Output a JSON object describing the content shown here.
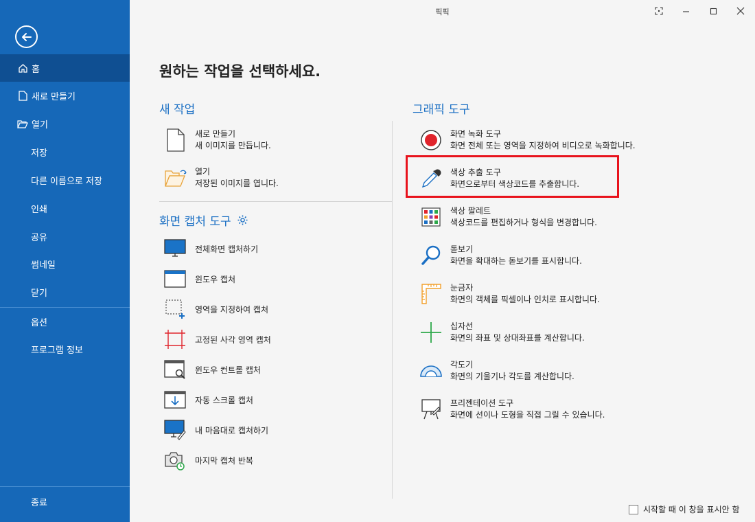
{
  "window": {
    "title": "픽픽"
  },
  "sidebar": {
    "items": [
      {
        "label": "홈",
        "icon": "home-icon"
      },
      {
        "label": "새로 만들기",
        "icon": "new-file-icon"
      },
      {
        "label": "열기",
        "icon": "folder-open-icon"
      },
      {
        "label": "저장"
      },
      {
        "label": "다른 이름으로 저장"
      },
      {
        "label": "인쇄"
      },
      {
        "label": "공유"
      },
      {
        "label": "썸네일"
      },
      {
        "label": "닫기"
      },
      {
        "label": "옵션"
      },
      {
        "label": "프로그램 정보"
      },
      {
        "label": "종료"
      }
    ]
  },
  "main": {
    "heading": "원하는 작업을 선택하세요.",
    "new_task": {
      "title": "새 작업",
      "items": [
        {
          "title": "새로 만들기",
          "desc": "새 이미지를 만듭니다."
        },
        {
          "title": "열기",
          "desc": "저장된 이미지를 엽니다."
        }
      ]
    },
    "capture": {
      "title": "화면 캡처 도구",
      "items": [
        {
          "label": "전체화면 캡처하기"
        },
        {
          "label": "윈도우 캡처"
        },
        {
          "label": "영역을 지정하여 캡처"
        },
        {
          "label": "고정된 사각 영역 캡처"
        },
        {
          "label": "윈도우 컨트롤 캡처"
        },
        {
          "label": "자동 스크롤 캡처"
        },
        {
          "label": "내 마음대로 캡처하기"
        },
        {
          "label": "마지막 캡처 반복"
        }
      ]
    },
    "graphic": {
      "title": "그래픽 도구",
      "items": [
        {
          "title": "화면 녹화 도구",
          "desc": "화면 전체 또는 영역을 지정하여 비디오로 녹화합니다."
        },
        {
          "title": "색상 추출 도구",
          "desc": "화면으로부터 색상코드를 추출합니다."
        },
        {
          "title": "색상 팔레트",
          "desc": "색상코드를 편집하거나 형식을 변경합니다."
        },
        {
          "title": "돋보기",
          "desc": "화면을 확대하는 돋보기를 표시합니다."
        },
        {
          "title": "눈금자",
          "desc": "화면의 객체를 픽셀이나 인치로 표시합니다."
        },
        {
          "title": "십자선",
          "desc": "화면의 좌표 및 상대좌표를 계산합니다."
        },
        {
          "title": "각도기",
          "desc": "화면의 기울기나 각도를 계산합니다."
        },
        {
          "title": "프리젠테이션 도구",
          "desc": "화면에 선이나 도형을 직접 그릴 수 있습니다."
        }
      ]
    }
  },
  "footer": {
    "dont_show_label": "시작할 때 이 창을 표시안 함"
  },
  "colors": {
    "sidebar": "#1668b8",
    "sidebar_active": "#0f4f92",
    "accent": "#1a6fc4",
    "highlight": "#e8121c"
  }
}
